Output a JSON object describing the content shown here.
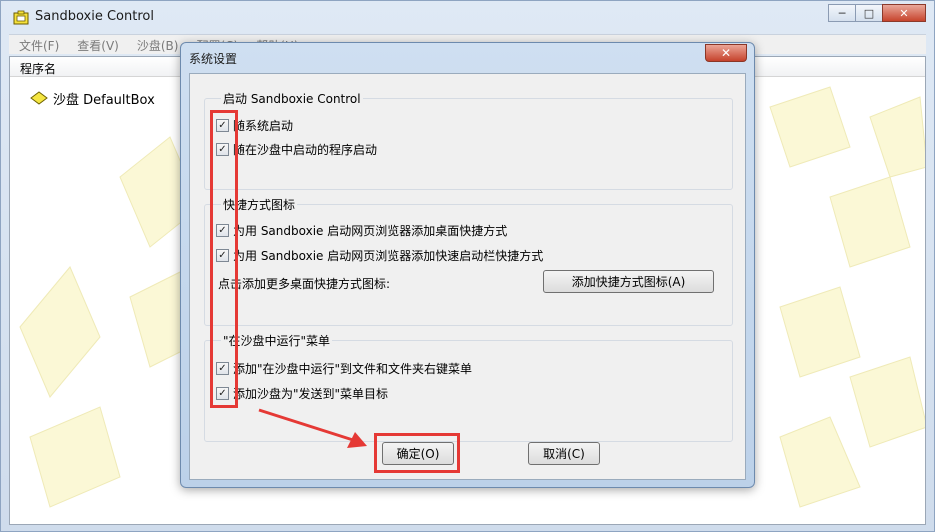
{
  "main_window": {
    "title": "Sandboxie Control",
    "window_buttons": {
      "minimize": "─",
      "maximize": "□",
      "close": "✕"
    },
    "menu": [
      "文件(F)",
      "查看(V)",
      "沙盘(B)",
      "配置(C)",
      "帮助(H)"
    ],
    "column_header": "程序名",
    "sandbox_name": "沙盘 DefaultBox"
  },
  "dialog": {
    "title": "系统设置",
    "close_glyph": "✕",
    "groups": {
      "startup": {
        "title": "启动 Sandboxie Control",
        "options": [
          {
            "label": "随系统启动",
            "checked": true
          },
          {
            "label": "随在沙盘中启动的程序启动",
            "checked": true
          }
        ]
      },
      "shortcuts": {
        "title": "快捷方式图标",
        "options": [
          {
            "label": "为用 Sandboxie 启动网页浏览器添加桌面快捷方式",
            "checked": true
          },
          {
            "label": "为用 Sandboxie 启动网页浏览器添加快速启动栏快捷方式",
            "checked": true
          }
        ],
        "more_label": "点击添加更多桌面快捷方式图标:",
        "add_button": "添加快捷方式图标(A)"
      },
      "context_menu": {
        "title": "\"在沙盘中运行\"菜单",
        "options": [
          {
            "label": "添加\"在沙盘中运行\"到文件和文件夹右键菜单",
            "checked": true
          },
          {
            "label": "添加沙盘为\"发送到\"菜单目标",
            "checked": true
          }
        ]
      }
    },
    "ok_button": "确定(O)",
    "cancel_button": "取消(C)",
    "check_glyph": "✓"
  },
  "colors": {
    "annotation_red": "#e53935",
    "sandbox_yellow": "#f5e642"
  }
}
